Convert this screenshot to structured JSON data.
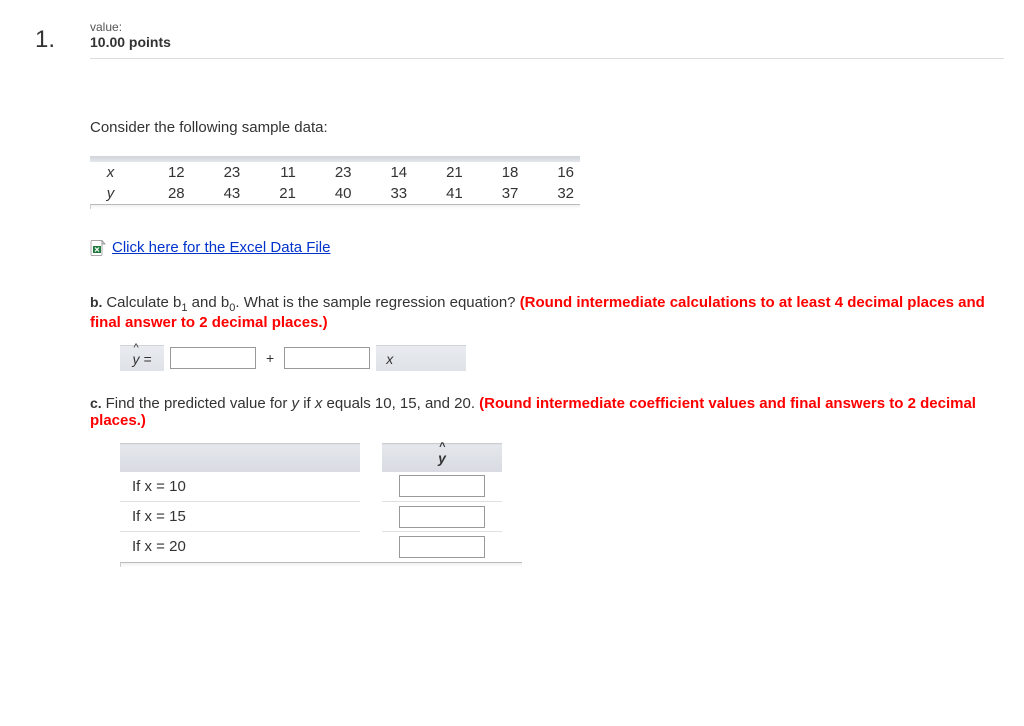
{
  "question_number": "1.",
  "value_label": "value:",
  "points": "10.00 points",
  "prompt": "Consider the following sample data:",
  "data": {
    "x_label": "x",
    "y_label": "y",
    "x": [
      "12",
      "23",
      "11",
      "23",
      "14",
      "21",
      "18",
      "16"
    ],
    "y": [
      "28",
      "43",
      "21",
      "40",
      "33",
      "41",
      "37",
      "32"
    ]
  },
  "excel_link": "Click here for the Excel Data File",
  "parts": {
    "b": {
      "label": "b.",
      "text_plain": "Calculate b₁ and b₀. What is the sample regression equation? ",
      "text_red": "(Round intermediate calculations to at least 4 decimal places and final answer to 2 decimal places.)",
      "yhat": "ŷ =",
      "plus": "+",
      "x": "x"
    },
    "c": {
      "label": "c.",
      "text_plain": "Find the predicted value for y if x equals 10, 15, and 20. ",
      "text_red": "(Round intermediate coefficient values and final answers to 2 decimal places.)",
      "yhat_header": "ŷ",
      "rows": [
        "If x = 10",
        "If x = 15",
        "If x = 20"
      ]
    }
  }
}
